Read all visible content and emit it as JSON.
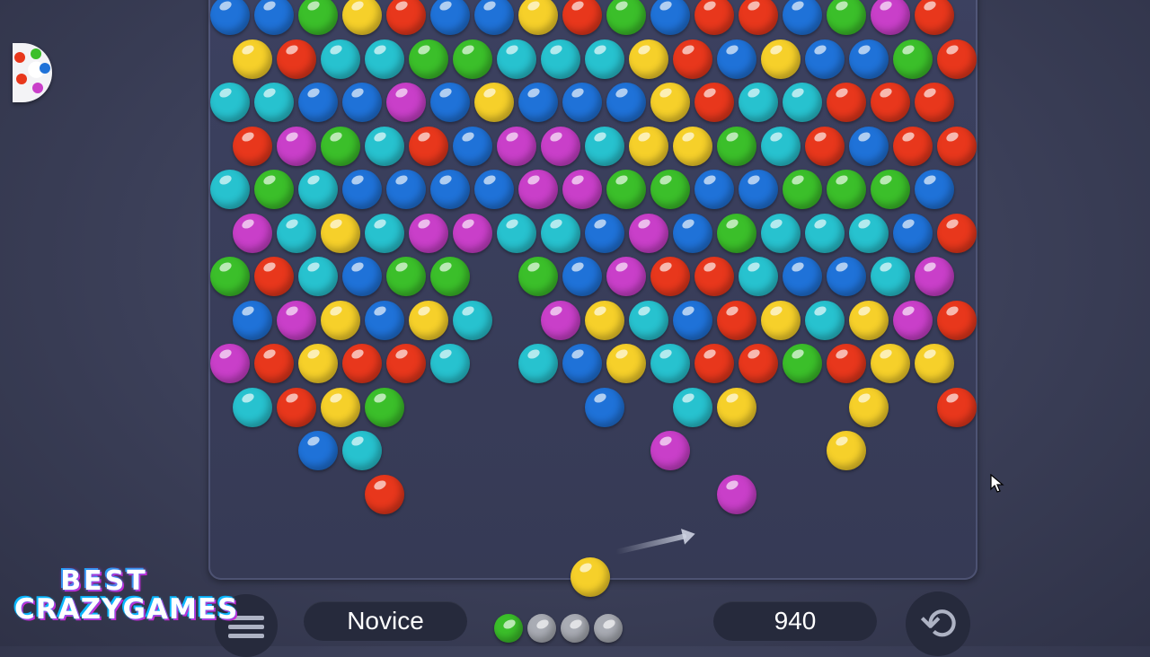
{
  "colors": {
    "R": "#e8371c",
    "Y": "#f6d02a",
    "G": "#3bbf2a",
    "B": "#1f72d8",
    "C": "#27c2cf",
    "M": "#c93fc9",
    "GR": "#a9acb4"
  },
  "grid": {
    "rows": [
      "BBGYRBBYRGBRRBGMR",
      "YRCCGGCCCYRBYBBGR",
      "CCBBMBYBBBYRCCRRR",
      "RMGCRBMMCYYGCRBRR",
      "CGCBBBBMMGGBBGGGB",
      "MCYCMMCCBMBGCCCBR",
      "GRCBGG.GBMRRCBBCM",
      "BMYBYC.MYCBRYCYMR",
      "MRYRRC.CBYCRRGRYY",
      "CRYG....B.CY..Y.R",
      "..BC......M...Y..",
      "...R.......M....."
    ]
  },
  "shooter": {
    "current_color": "Y",
    "queue": [
      "G",
      "GR",
      "GR",
      "GR"
    ]
  },
  "hud": {
    "level": "Novice",
    "score": "940",
    "menu_icon": "hamburger-menu-icon",
    "undo_icon": "undo-arrow-icon",
    "undo_glyph": "⟲"
  },
  "logo": {
    "line1": "BEST",
    "line2": "CRAZYGAMES"
  }
}
